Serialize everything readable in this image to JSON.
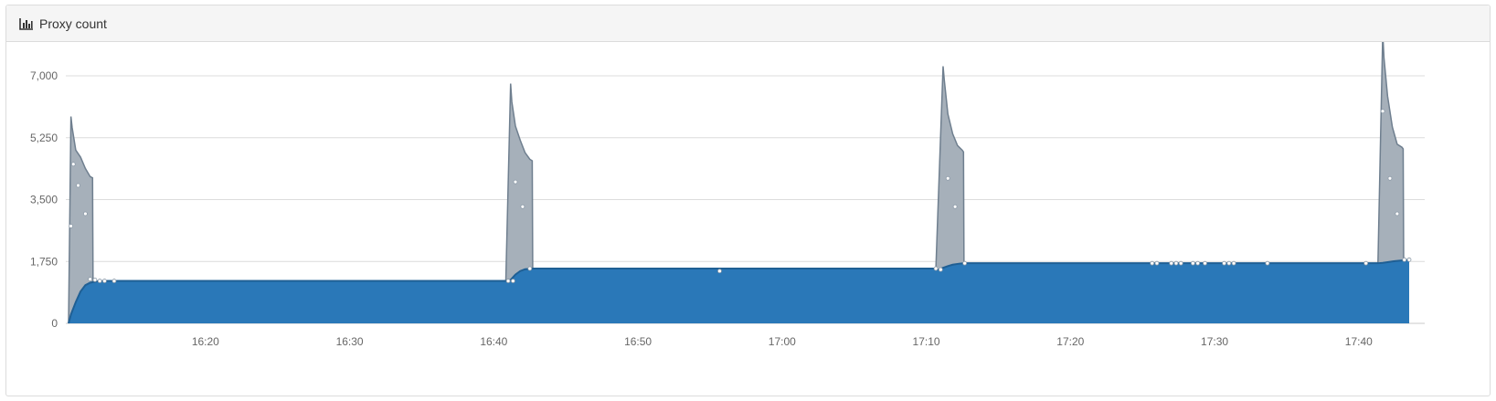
{
  "panel": {
    "title": "Proxy count",
    "icon": "bar-chart-icon"
  },
  "chart_data": {
    "type": "area",
    "stacked": true,
    "title": "",
    "xlabel": "",
    "ylabel": "",
    "ylim": [
      0,
      7000
    ],
    "yticks": [
      0,
      1750,
      3500,
      5250,
      7000
    ],
    "ytick_labels": [
      "0",
      "1,750",
      "3,500",
      "5,250",
      "7,000"
    ],
    "xlim": [
      "16:10:30",
      "17:43:30"
    ],
    "xticks": [
      "16:20",
      "16:30",
      "16:40",
      "16:50",
      "17:00",
      "17:10",
      "17:20",
      "17:30",
      "17:40"
    ],
    "grid": true,
    "legend": "none",
    "colors": {
      "base": "#2a78b8",
      "base_line": "#1f5f94",
      "spike": "#a6b0ba",
      "spike_line": "#6f7f8f",
      "grid": "#dcdcdc",
      "tick_text": "#666666"
    },
    "series": [
      {
        "color": "#2a78b8",
        "points": [
          [
            "16:10:30",
            0
          ],
          [
            "16:10:40",
            250
          ],
          [
            "16:11:00",
            600
          ],
          [
            "16:11:20",
            900
          ],
          [
            "16:11:40",
            1080
          ],
          [
            "16:12:00",
            1150
          ],
          [
            "16:12:30",
            1190
          ],
          [
            "16:13:00",
            1200
          ],
          [
            "16:40:50",
            1200
          ],
          [
            "16:41:10",
            1230
          ],
          [
            "16:41:30",
            1380
          ],
          [
            "16:41:50",
            1480
          ],
          [
            "16:42:10",
            1530
          ],
          [
            "16:42:30",
            1540
          ],
          [
            "16:42:45",
            1550
          ],
          [
            "17:10:40",
            1550
          ],
          [
            "17:10:50",
            1520
          ],
          [
            "17:11:10",
            1570
          ],
          [
            "17:11:30",
            1620
          ],
          [
            "17:11:50",
            1660
          ],
          [
            "17:12:20",
            1690
          ],
          [
            "17:12:40",
            1700
          ],
          [
            "17:41:20",
            1700
          ],
          [
            "17:41:40",
            1710
          ],
          [
            "17:42:00",
            1730
          ],
          [
            "17:42:30",
            1760
          ],
          [
            "17:43:00",
            1780
          ],
          [
            "17:43:30",
            1800
          ]
        ]
      },
      {
        "color": "#a6b0ba",
        "points": [
          [
            "16:10:30",
            0
          ],
          [
            "16:10:40",
            5600
          ],
          [
            "16:10:45",
            5200
          ],
          [
            "16:11:00",
            4300
          ],
          [
            "16:11:20",
            3800
          ],
          [
            "16:11:40",
            3300
          ],
          [
            "16:12:00",
            3000
          ],
          [
            "16:12:10",
            2950
          ],
          [
            "16:12:12",
            0
          ],
          [
            "16:40:50",
            0
          ],
          [
            "16:41:10",
            5550
          ],
          [
            "16:41:15",
            5000
          ],
          [
            "16:41:30",
            4200
          ],
          [
            "16:41:50",
            3700
          ],
          [
            "16:42:10",
            3300
          ],
          [
            "16:42:30",
            3100
          ],
          [
            "16:42:40",
            3050
          ],
          [
            "16:42:42",
            0
          ],
          [
            "17:10:40",
            0
          ],
          [
            "17:11:10",
            5700
          ],
          [
            "17:11:15",
            5300
          ],
          [
            "17:11:30",
            4300
          ],
          [
            "17:11:50",
            3700
          ],
          [
            "17:12:10",
            3350
          ],
          [
            "17:12:30",
            3200
          ],
          [
            "17:12:35",
            3150
          ],
          [
            "17:12:37",
            0
          ],
          [
            "17:41:20",
            0
          ],
          [
            "17:41:40",
            6500
          ],
          [
            "17:41:45",
            5800
          ],
          [
            "17:42:00",
            4700
          ],
          [
            "17:42:20",
            3800
          ],
          [
            "17:42:40",
            3300
          ],
          [
            "17:43:00",
            3200
          ],
          [
            "17:43:05",
            3150
          ],
          [
            "17:43:07",
            0
          ],
          [
            "17:43:30",
            0
          ]
        ]
      }
    ],
    "scatter_points": [
      [
        "16:10:40",
        2750
      ],
      [
        "16:10:50",
        4500
      ],
      [
        "16:11:10",
        3900
      ],
      [
        "16:11:40",
        3100
      ],
      [
        "16:12:00",
        1250
      ],
      [
        "16:12:20",
        1230
      ],
      [
        "16:12:40",
        1200
      ],
      [
        "16:13:00",
        1200
      ],
      [
        "16:13:40",
        1200
      ],
      [
        "16:41:00",
        1200
      ],
      [
        "16:41:20",
        1200
      ],
      [
        "16:41:30",
        4000
      ],
      [
        "16:42:00",
        3300
      ],
      [
        "16:42:30",
        1550
      ],
      [
        "16:55:40",
        1480
      ],
      [
        "17:10:40",
        1550
      ],
      [
        "17:11:00",
        1520
      ],
      [
        "17:11:30",
        4100
      ],
      [
        "17:12:00",
        3300
      ],
      [
        "17:12:40",
        1700
      ],
      [
        "17:25:40",
        1700
      ],
      [
        "17:26:00",
        1700
      ],
      [
        "17:27:00",
        1700
      ],
      [
        "17:27:20",
        1700
      ],
      [
        "17:27:40",
        1700
      ],
      [
        "17:28:30",
        1700
      ],
      [
        "17:28:50",
        1700
      ],
      [
        "17:29:20",
        1700
      ],
      [
        "17:30:40",
        1700
      ],
      [
        "17:31:00",
        1700
      ],
      [
        "17:31:20",
        1700
      ],
      [
        "17:33:40",
        1700
      ],
      [
        "17:40:30",
        1700
      ],
      [
        "17:41:40",
        6000
      ],
      [
        "17:42:10",
        4100
      ],
      [
        "17:42:40",
        3100
      ],
      [
        "17:43:10",
        1800
      ],
      [
        "17:43:30",
        1800
      ]
    ]
  }
}
